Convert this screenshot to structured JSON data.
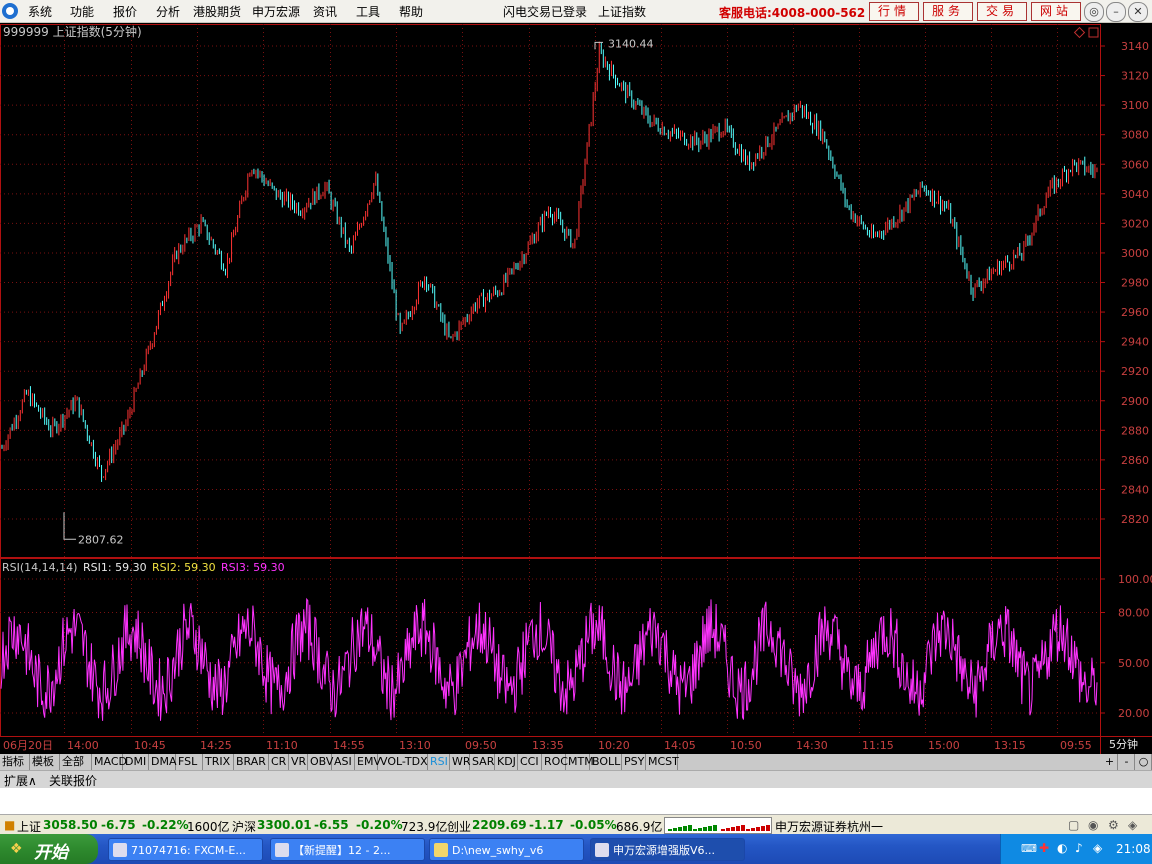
{
  "menubar": {
    "items": [
      "系统",
      "功能",
      "报价",
      "分析",
      "港股期货",
      "申万宏源",
      "资讯",
      "工具",
      "帮助"
    ],
    "center": [
      "闪电交易已登录",
      "上证指数"
    ],
    "hotline": "客服电话:4008-000-562",
    "buttons": [
      "行情",
      "服务",
      "交易",
      "网站"
    ]
  },
  "chart_header": {
    "code_title": "999999 上证指数(5分钟)",
    "high_label": "3140.44",
    "low_label": "2807.62"
  },
  "rsi_header": {
    "name": "RSI(14,14,14)",
    "rsi1": "RSI1: 59.30",
    "rsi2": "RSI2: 59.30",
    "rsi3": "RSI3: 59.30"
  },
  "period_label": "5分钟",
  "chart_data": [
    {
      "type": "candlestick",
      "title": "999999 上证指数(5分钟)",
      "y_ticks": [
        3140,
        3120,
        3100,
        3080,
        3060,
        3040,
        3020,
        3000,
        2980,
        2960,
        2940,
        2920,
        2900,
        2880,
        2860,
        2840,
        2820
      ],
      "ylim": [
        2800,
        3145
      ],
      "x_tick_labels": [
        "06月20日",
        "14:00",
        "10:45",
        "14:25",
        "11:10",
        "14:55",
        "13:10",
        "09:50",
        "13:35",
        "10:20",
        "14:05",
        "10:50",
        "14:30",
        "11:15",
        "15:00",
        "13:15",
        "09:55"
      ],
      "high": 3140.44,
      "low": 2807.62,
      "close_path": [
        2868,
        2905,
        2880,
        2900,
        2850,
        2885,
        2940,
        3000,
        3020,
        2990,
        3060,
        3040,
        3030,
        3045,
        3000,
        3050,
        2945,
        2985,
        2940,
        2965,
        2975,
        3000,
        3030,
        3005,
        3135,
        3110,
        3090,
        3080,
        3075,
        3085,
        3060,
        3080,
        3100,
        3080,
        3030,
        3010,
        3025,
        3045,
        3030,
        2975,
        2990,
        3000,
        3040,
        3060,
        3055
      ]
    },
    {
      "type": "line",
      "title": "RSI(14,14,14)",
      "y_ticks": [
        100,
        80,
        50,
        20
      ],
      "ylim": [
        10,
        105
      ],
      "series": [
        {
          "name": "RSI1",
          "value": 59.3
        },
        {
          "name": "RSI2",
          "value": 59.3
        },
        {
          "name": "RSI3",
          "value": 59.3
        }
      ]
    }
  ],
  "indicator_tabs": [
    "指标",
    "模板",
    "全部",
    "MACD",
    "DMI",
    "DMA",
    "FSL",
    "TRIX",
    "BRAR",
    "CR",
    "VR",
    "OBV",
    "ASI",
    "EMV",
    "VOL-TDX",
    "RSI",
    "WR",
    "SAR",
    "KDJ",
    "CCI",
    "ROC",
    "MTM",
    "BOLL",
    "PSY",
    "MCST"
  ],
  "indicator_tabs_active": "RSI",
  "right_controls": [
    "+",
    "-",
    "○"
  ],
  "ext_tabs": [
    "扩展∧",
    "关联报价"
  ],
  "statusbar": {
    "sh_name": "上证",
    "sh_price": "3058.50",
    "sh_chg": "-6.75",
    "sh_pct": "-0.22%",
    "sh_amt": "1600亿",
    "hs_name": "沪深",
    "hs_price": "3300.01",
    "hs_chg": "-6.55",
    "hs_pct": "-0.20%",
    "hs_amt": "723.9亿",
    "cy_name": "创业",
    "cy_price": "2209.69",
    "cy_chg": "-1.17",
    "cy_pct": "-0.05%",
    "cy_amt": "686.9亿",
    "broker": "申万宏源证券杭州一"
  },
  "taskbar": {
    "start": "开始",
    "tasks": [
      "71074716: FXCM-E...",
      "【新提醒】12 - 2...",
      "D:\\new_swhy_v6",
      "申万宏源增强版V6..."
    ],
    "clock": "21:08"
  },
  "colors": {
    "up": "#ff3333",
    "down": "#54ffff",
    "rsi": "#ff33ff",
    "grid": "#7a1010",
    "axis": "#b01010",
    "tick_text": "#c84040"
  }
}
